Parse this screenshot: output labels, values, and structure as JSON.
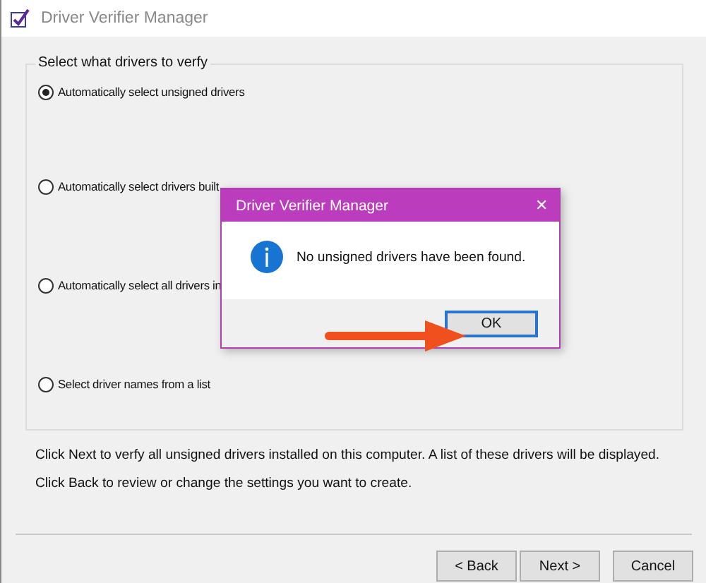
{
  "window": {
    "title": "Driver Verifier Manager"
  },
  "group": {
    "legend": "Select what drivers to verfy",
    "options": [
      {
        "label": "Automatically select unsigned drivers",
        "selected": true
      },
      {
        "label": "Automatically select drivers built",
        "selected": false
      },
      {
        "label": "Automatically select all drivers in",
        "selected": false
      },
      {
        "label": "Select driver names from a list",
        "selected": false
      }
    ]
  },
  "info": [
    "Click Next to verfy all unsigned drivers installed on this computer. A list of these drivers will be displayed.",
    "Click Back to review or change the settings you want to create."
  ],
  "buttons": [
    {
      "label": "< Back",
      "default": false
    },
    {
      "label": "Next >",
      "default": false
    },
    {
      "label": "Cancel",
      "default": false
    }
  ],
  "dialog": {
    "title": "Driver Verifier Manager",
    "close": "✕",
    "message": "No unsigned drivers have been found.",
    "buttons": [
      {
        "label": "OK",
        "default": true
      }
    ]
  }
}
